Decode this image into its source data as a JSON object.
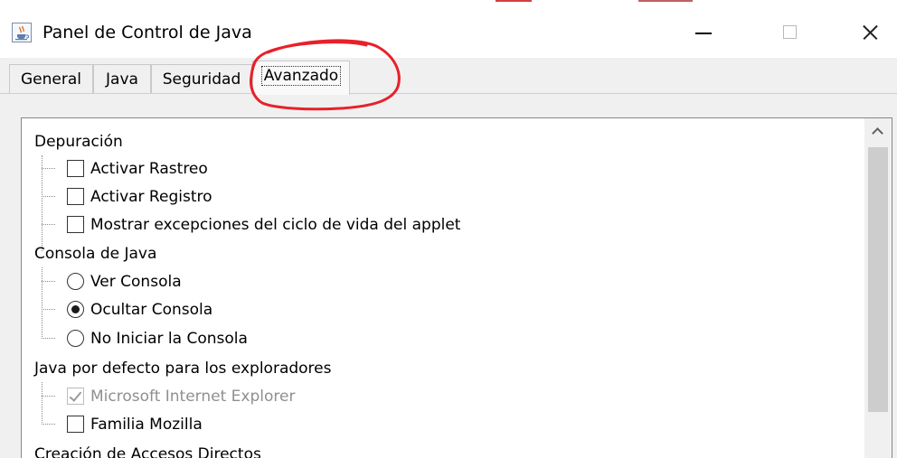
{
  "window": {
    "title": "Panel de Control de Java",
    "app_icon": "java-cup-icon",
    "controls": [
      "minimize-icon",
      "maximize-icon",
      "close-icon"
    ]
  },
  "tabs": [
    {
      "label": "General",
      "active": false
    },
    {
      "label": "Java",
      "active": false
    },
    {
      "label": "Seguridad",
      "active": false
    },
    {
      "label": "Avanzado",
      "active": true
    }
  ],
  "tree": {
    "depuracion": {
      "label": "Depuración",
      "items": [
        {
          "label": "Activar Rastreo",
          "checked": false
        },
        {
          "label": "Activar Registro",
          "checked": false
        },
        {
          "label": "Mostrar excepciones del ciclo de vida del applet",
          "checked": false
        }
      ]
    },
    "consola": {
      "label": "Consola de Java",
      "items": [
        {
          "label": "Ver Consola",
          "selected": false
        },
        {
          "label": "Ocultar Consola",
          "selected": true
        },
        {
          "label": "No Iniciar la Consola",
          "selected": false
        }
      ]
    },
    "exploradores": {
      "label": "Java por defecto para los exploradores",
      "items": [
        {
          "label": "Microsoft Internet Explorer",
          "checked": true,
          "disabled": true
        },
        {
          "label": "Familia Mozilla",
          "checked": false
        }
      ]
    },
    "accesos": {
      "label": "Creación de Accesos Directos"
    }
  },
  "annotation": {
    "shape": "freehand-circle",
    "target": "Avanzado tab",
    "color": "#e8202a"
  }
}
